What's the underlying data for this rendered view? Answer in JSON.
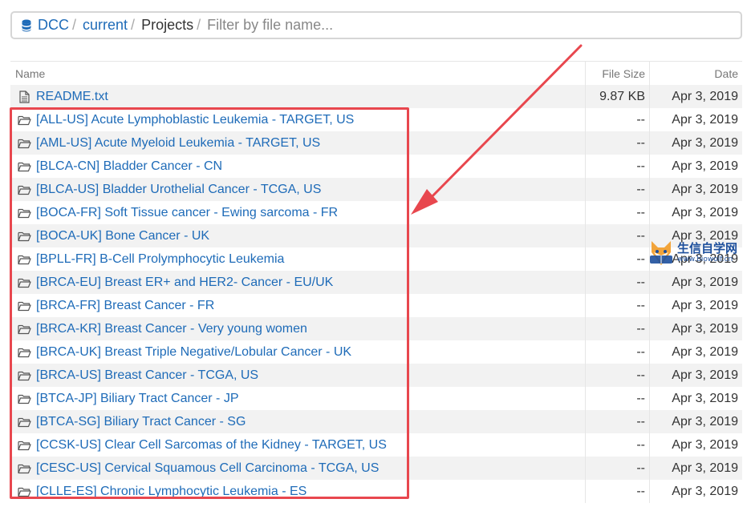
{
  "breadcrumb": {
    "root_label": "DCC",
    "current_label": "current",
    "projects_label": "Projects",
    "filter_placeholder": "Filter by file name...",
    "separator": "/"
  },
  "table": {
    "headers": {
      "name": "Name",
      "size": "File Size",
      "date": "Date"
    },
    "rows": [
      {
        "name": "README.txt",
        "size": "9.87 KB",
        "date": "Apr 3, 2019",
        "type": "file"
      },
      {
        "name": "[ALL-US] Acute Lymphoblastic Leukemia - TARGET, US",
        "size": "--",
        "date": "Apr 3, 2019",
        "type": "folder"
      },
      {
        "name": "[AML-US] Acute Myeloid Leukemia - TARGET, US",
        "size": "--",
        "date": "Apr 3, 2019",
        "type": "folder"
      },
      {
        "name": "[BLCA-CN] Bladder Cancer - CN",
        "size": "--",
        "date": "Apr 3, 2019",
        "type": "folder"
      },
      {
        "name": "[BLCA-US] Bladder Urothelial Cancer - TCGA, US",
        "size": "--",
        "date": "Apr 3, 2019",
        "type": "folder"
      },
      {
        "name": "[BOCA-FR] Soft Tissue cancer - Ewing sarcoma - FR",
        "size": "--",
        "date": "Apr 3, 2019",
        "type": "folder"
      },
      {
        "name": "[BOCA-UK] Bone Cancer - UK",
        "size": "--",
        "date": "Apr 3, 2019",
        "type": "folder"
      },
      {
        "name": "[BPLL-FR] B-Cell Prolymphocytic Leukemia",
        "size": "--",
        "date": "Apr 3, 2019",
        "type": "folder"
      },
      {
        "name": "[BRCA-EU] Breast ER+ and HER2- Cancer - EU/UK",
        "size": "--",
        "date": "Apr 3, 2019",
        "type": "folder"
      },
      {
        "name": "[BRCA-FR] Breast Cancer - FR",
        "size": "--",
        "date": "Apr 3, 2019",
        "type": "folder"
      },
      {
        "name": "[BRCA-KR] Breast Cancer - Very young women",
        "size": "--",
        "date": "Apr 3, 2019",
        "type": "folder"
      },
      {
        "name": "[BRCA-UK] Breast Triple Negative/Lobular Cancer - UK",
        "size": "--",
        "date": "Apr 3, 2019",
        "type": "folder"
      },
      {
        "name": "[BRCA-US] Breast Cancer - TCGA, US",
        "size": "--",
        "date": "Apr 3, 2019",
        "type": "folder"
      },
      {
        "name": "[BTCA-JP] Biliary Tract Cancer - JP",
        "size": "--",
        "date": "Apr 3, 2019",
        "type": "folder"
      },
      {
        "name": "[BTCA-SG] Biliary Tract Cancer - SG",
        "size": "--",
        "date": "Apr 3, 2019",
        "type": "folder"
      },
      {
        "name": "[CCSK-US] Clear Cell Sarcomas of the Kidney - TARGET, US",
        "size": "--",
        "date": "Apr 3, 2019",
        "type": "folder"
      },
      {
        "name": "[CESC-US] Cervical Squamous Cell Carcinoma - TCGA, US",
        "size": "--",
        "date": "Apr 3, 2019",
        "type": "folder"
      },
      {
        "name": "[CLLE-ES] Chronic Lymphocytic Leukemia - ES",
        "size": "--",
        "date": "Apr 3, 2019",
        "type": "folder"
      }
    ]
  },
  "annotation": {
    "color": "#e8474e"
  },
  "watermark": {
    "title": "生信自学网",
    "subtitle": "www.biowolf.cn"
  },
  "colors": {
    "link": "#1e6bb8",
    "row_alt": "#f2f2f2",
    "annotation": "#e8474e"
  }
}
